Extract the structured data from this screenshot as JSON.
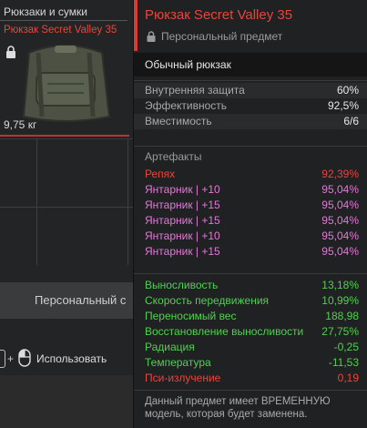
{
  "sidebar": {
    "category": "Рюкзаки и сумки",
    "item_name": "Рюкзак Secret Valley 35",
    "weight": "9,75 кг",
    "personal_button": "Персональный с",
    "use_label": "Использовать",
    "plus": "+"
  },
  "tooltip": {
    "title": "Рюкзак Secret Valley 35",
    "personal": "Персональный предмет",
    "item_type": "Обычный рюкзак",
    "stats": [
      {
        "label": "Внутренняя защита",
        "value": "60%"
      },
      {
        "label": "Эффективность",
        "value": "92,5%"
      },
      {
        "label": "Вместимость",
        "value": "6/6"
      }
    ],
    "artifacts_header": "Артефакты",
    "artifacts": [
      {
        "label": "Репях",
        "value": "92,39%",
        "color": "#e8453c"
      },
      {
        "label": "Янтарник | +10",
        "value": "95,04%",
        "color": "#e07ad6"
      },
      {
        "label": "Янтарник | +15",
        "value": "95,04%",
        "color": "#e07ad6"
      },
      {
        "label": "Янтарник | +15",
        "value": "95,04%",
        "color": "#e07ad6"
      },
      {
        "label": "Янтарник | +10",
        "value": "95,04%",
        "color": "#e07ad6"
      },
      {
        "label": "Янтарник | +15",
        "value": "95,04%",
        "color": "#e07ad6"
      }
    ],
    "properties": [
      {
        "label": "Выносливость",
        "value": "13,18%",
        "color": "#4fd14f"
      },
      {
        "label": "Скорость передвижения",
        "value": "10,99%",
        "color": "#4fd14f"
      },
      {
        "label": "Переносимый вес",
        "value": "188,98",
        "color": "#4fd14f"
      },
      {
        "label": "Восстановление выносливости",
        "value": "27,75%",
        "color": "#4fd14f"
      },
      {
        "label": "Радиация",
        "value": "-0,25",
        "color": "#4fd14f"
      },
      {
        "label": "Температура",
        "value": "-11,53",
        "color": "#4fd14f"
      },
      {
        "label": "Пси-излучение",
        "value": "0,19",
        "color": "#e8453c"
      }
    ],
    "note_line1": "Данный предмет имеет ВРЕМЕННУЮ",
    "note_line2": "модель, которая будет заменена."
  },
  "colors": {
    "accent": "#d83a36",
    "positive": "#4fd14f",
    "artifact": "#e07ad6"
  }
}
